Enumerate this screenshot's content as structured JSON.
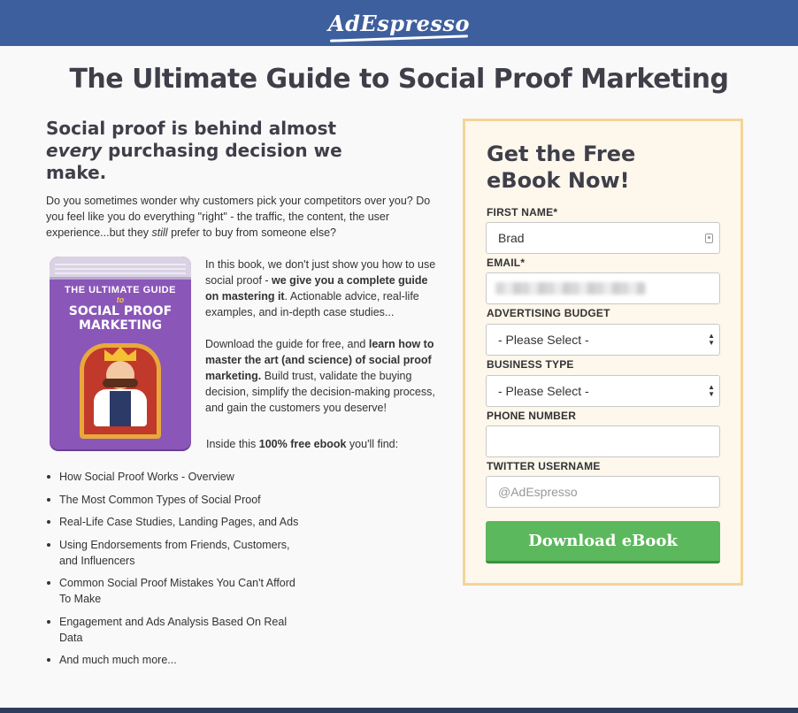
{
  "header": {
    "logo_text": "AdEspresso"
  },
  "page_title": "The Ultimate Guide to Social Proof Marketing",
  "headline": {
    "part1": "Social proof is behind almost ",
    "emphasis": "every",
    "part2": " purchasing decision we make."
  },
  "intro": {
    "part1": "Do you sometimes wonder why customers pick your competitors over you? Do you feel like you do everything \"right\" - the traffic, the content, the user experience...but they ",
    "emphasis": "still",
    "part2": " prefer to buy from someone else?"
  },
  "book": {
    "title_line1": "THE ULTIMATE GUIDE",
    "title_line2": "to",
    "title_line3": "SOCIAL PROOF",
    "title_line4": "MARKETING"
  },
  "paragraph1": {
    "part1": "In this book, we don't just show you how to use social proof - ",
    "bold": "we give you a complete guide on mastering it",
    "part2": ". Actionable advice, real-life examples, and in-depth case studies..."
  },
  "paragraph2": {
    "part1": "Download the guide for free, and ",
    "bold": "learn how to master the art (and science) of social proof marketing.",
    "part2": " Build trust, validate the buying decision, simplify the decision-making process, and gain the customers you deserve!"
  },
  "inside": {
    "part1": "Inside this ",
    "bold": "100% free ebook",
    "part2": " you'll find:"
  },
  "features": [
    "How Social Proof Works - Overview",
    "The Most Common Types of Social Proof",
    "Real-Life Case Studies, Landing Pages, and Ads",
    "Using Endorsements from Friends, Customers, and Influencers",
    "Common Social Proof Mistakes You Can't Afford To Make",
    "Engagement and Ads Analysis Based On Real Data",
    "And much much more..."
  ],
  "form": {
    "heading": "Get the Free eBook Now!",
    "first_name_label": "FIRST NAME*",
    "first_name_value": "Brad",
    "email_label": "EMAIL*",
    "budget_label": "ADVERTISING BUDGET",
    "budget_value": "- Please Select -",
    "business_label": "BUSINESS TYPE",
    "business_value": "- Please Select -",
    "phone_label": "PHONE NUMBER",
    "twitter_label": "TWITTER USERNAME",
    "twitter_placeholder": "@AdEspresso",
    "submit_label": "Download eBook"
  },
  "colors": {
    "header_bg": "#3e5f9d",
    "button_green": "#5cb85c",
    "form_border": "#f4d49a",
    "form_bg": "#fdf7ec"
  },
  "icons": [
    "contact-card-icon",
    "select-arrows-icon"
  ]
}
